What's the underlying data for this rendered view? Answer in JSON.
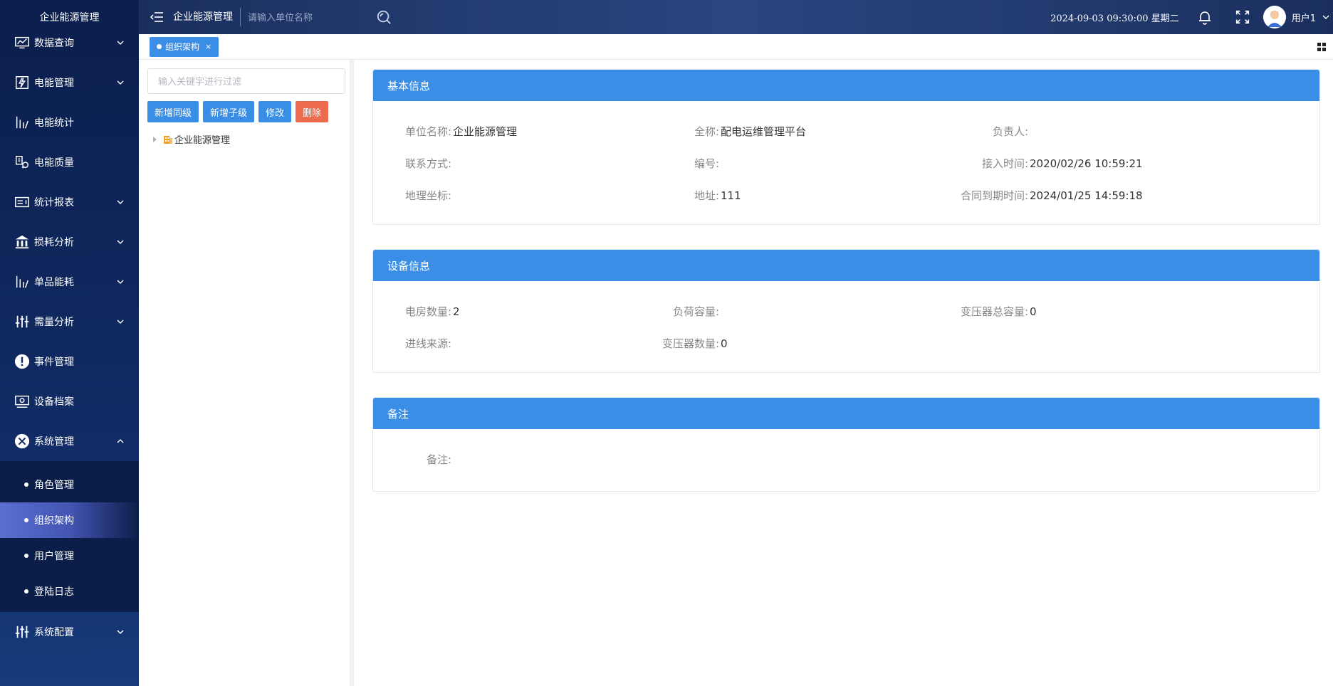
{
  "app": {
    "brand": "企业能源管理"
  },
  "sidebar": {
    "items": [
      {
        "label": "数据查询",
        "icon": "monitor-chart-icon",
        "expandable": true,
        "expanded": false
      },
      {
        "label": "电能管理",
        "icon": "electric-meter-icon",
        "expandable": true,
        "expanded": false
      },
      {
        "label": "电能统计",
        "icon": "bar-stats-icon",
        "expandable": false
      },
      {
        "label": "电能质量",
        "icon": "quality-plug-icon",
        "expandable": false
      },
      {
        "label": "统计报表",
        "icon": "report-icon",
        "expandable": true,
        "expanded": false
      },
      {
        "label": "损耗分析",
        "icon": "bank-building-icon",
        "expandable": true,
        "expanded": false
      },
      {
        "label": "单品能耗",
        "icon": "bar-stats-icon",
        "expandable": true,
        "expanded": false
      },
      {
        "label": "需量分析",
        "icon": "sliders-icon",
        "expandable": true,
        "expanded": false
      },
      {
        "label": "事件管理",
        "icon": "alert-circle-icon",
        "expandable": false
      },
      {
        "label": "设备档案",
        "icon": "device-monitor-icon",
        "expandable": false
      },
      {
        "label": "系统管理",
        "icon": "tools-icon",
        "expandable": true,
        "expanded": true
      }
    ],
    "system_sub": [
      {
        "label": "角色管理",
        "active": false
      },
      {
        "label": "组织架构",
        "active": true
      },
      {
        "label": "用户管理",
        "active": false
      },
      {
        "label": "登陆日志",
        "active": false
      }
    ],
    "last_item": {
      "label": "系统配置",
      "icon": "sliders-icon",
      "expandable": true,
      "expanded": false
    }
  },
  "header": {
    "title": "企业能源管理",
    "search_placeholder": "请输入单位名称",
    "datetime": "2024-09-03 09:30:00 星期二",
    "username": "用户1"
  },
  "tabs": [
    {
      "label": "组织架构",
      "close": "×"
    }
  ],
  "tree": {
    "filter_placeholder": "输入关键字进行过滤",
    "buttons": {
      "add_sibling": "新增同级",
      "add_child": "新增子级",
      "edit": "修改",
      "delete": "删除"
    },
    "root": "企业能源管理"
  },
  "basic": {
    "title": "基本信息",
    "rows": [
      [
        {
          "label": "单位名称:",
          "value": "企业能源管理"
        },
        {
          "label": "全称:",
          "value": "配电运维管理平台"
        },
        {
          "label": "负责人:",
          "value": ""
        }
      ],
      [
        {
          "label": "联系方式:",
          "value": ""
        },
        {
          "label": "编号:",
          "value": ""
        },
        {
          "label": "接入时间:",
          "value": "2020/02/26 10:59:21"
        }
      ],
      [
        {
          "label": "地理坐标:",
          "value": ""
        },
        {
          "label": "地址:",
          "value": "111"
        },
        {
          "label": "合同到期时间:",
          "value": "2024/01/25 14:59:18"
        }
      ]
    ]
  },
  "device": {
    "title": "设备信息",
    "rows": [
      [
        {
          "label": "电房数量:",
          "value": "2"
        },
        {
          "label": "负荷容量:",
          "value": ""
        },
        {
          "label": "变压器总容量:",
          "value": "0"
        }
      ],
      [
        {
          "label": "进线来源:",
          "value": ""
        },
        {
          "label": "变压器数量:",
          "value": "0"
        }
      ]
    ]
  },
  "remark": {
    "title": "备注",
    "label": "备注:",
    "value": ""
  },
  "colors": {
    "primary": "#3a8ee6",
    "danger": "#ec6a4e",
    "sidebar": "#0b1f4d"
  }
}
